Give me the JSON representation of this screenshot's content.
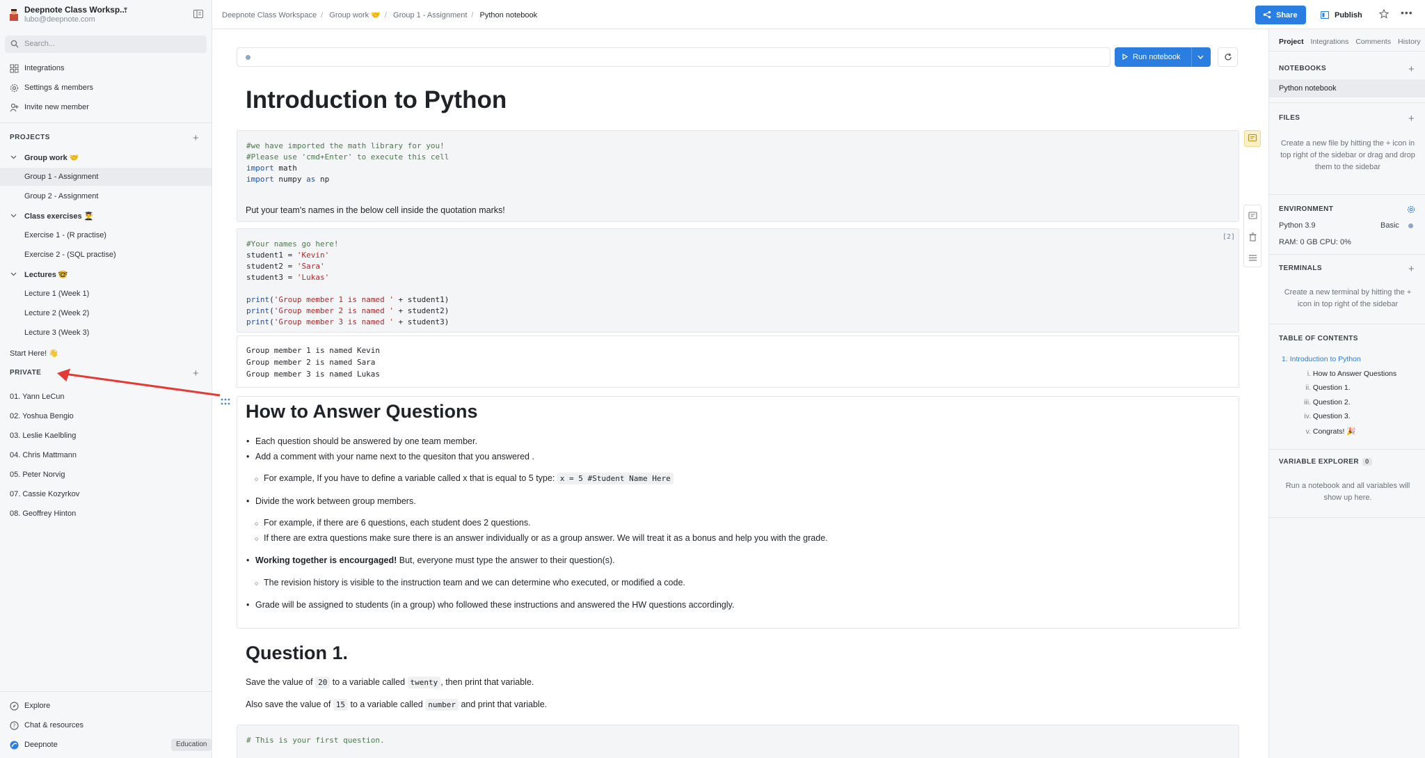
{
  "workspace": {
    "name": "Deepnote Class Worksp...",
    "email": "lubo@deepnote.com"
  },
  "search": {
    "placeholder": "Search..."
  },
  "nav": [
    {
      "label": "Integrations",
      "icon": "grid-icon"
    },
    {
      "label": "Settings & members",
      "icon": "gear-icon"
    },
    {
      "label": "Invite new member",
      "icon": "add-user-icon"
    }
  ],
  "projects": {
    "title": "PROJECTS",
    "items": [
      {
        "label": "Group work 🤝"
      },
      {
        "label": "Group 1 - Assignment"
      },
      {
        "label": "Group 2 - Assignment"
      },
      {
        "label": "Class exercises 👨‍🎓"
      },
      {
        "label": "Exercise 1 - (R practise)"
      },
      {
        "label": "Exercise 2 - (SQL practise)"
      },
      {
        "label": "Lectures 🤓"
      },
      {
        "label": "Lecture 1 (Week 1)"
      },
      {
        "label": "Lecture 2 (Week 2)"
      },
      {
        "label": "Lecture 3 (Week 3)"
      },
      {
        "label": "Start Here! 👋"
      }
    ]
  },
  "private": {
    "title": "PRIVATE",
    "items": [
      "01. Yann LeCun",
      "02. Yoshua Bengio",
      "03. Leslie Kaelbling",
      "04. Chris Mattmann",
      "05. Peter Norvig",
      "07. Cassie Kozyrkov",
      "08. Geoffrey Hinton"
    ]
  },
  "footer": {
    "explore": "Explore",
    "chat": "Chat & resources",
    "deepnote": "Deepnote",
    "badge": "Education"
  },
  "breadcrumb": [
    "Deepnote Class Workspace",
    "Group work 🤝",
    "Group 1 - Assignment",
    "Python notebook"
  ],
  "topbar": {
    "share": "Share",
    "publish": "Publish"
  },
  "toolbar": {
    "run": "Run notebook"
  },
  "notebook": {
    "title": "Introduction to Python",
    "cell1": {
      "line1": "#we have imported the math library for you!",
      "line2": "#Please use 'cmd+Enter' to execute this cell",
      "line3_kw": "import",
      "line3_rest": " math",
      "line4_kw": "import",
      "line4_mid": " numpy ",
      "line4_as": "as",
      "line4_end": " np"
    },
    "para1": "Put your team's names in the below cell inside the quotation marks!",
    "cell2": {
      "index": "[2]",
      "comment": "#Your names go here!",
      "s1_var": "student1 = ",
      "s1_val": "'Kevin'",
      "s2_var": "student2 = ",
      "s2_val": "'Sara'",
      "s3_var": "student3 = ",
      "s3_val": "'Lukas'",
      "print": "print",
      "p1_str": "'Group member 1 is named '",
      "p1_end": " + student1)",
      "p2_str": "'Group member 2 is named '",
      "p2_end": " + student2)",
      "p3_str": "'Group member 3 is named '",
      "p3_end": " + student3)"
    },
    "output": [
      "Group member 1 is named Kevin",
      "Group member 2 is named Sara",
      "Group member 3 is named Lukas"
    ],
    "howto": {
      "title": "How to Answer Questions",
      "b1": "Each question should be answered by one team member.",
      "b2": "Add a comment with your name next to the quesiton that you answered .",
      "b2a": "For example, If you have to define a variable called x that is equal to 5 type: ",
      "b2a_code": "x = 5 #Student Name Here",
      "b3": "Divide the work between group members.",
      "b3a": "For example, if there are 6 questions, each student does 2 questions.",
      "b3b": "If there are extra questions make sure there is an answer individually or as a group answer. We will treat it as a bonus and help you with the grade.",
      "b4_bold": "Working together is encourgaged!",
      "b4_rest": " But, everyone must type the answer to their question(s).",
      "b4a": "The revision history is visible to the instruction team and we can determine who executed, or modified a code.",
      "b5": "Grade will be assigned to students (in a group) who followed these instructions and answered the HW questions accordingly."
    },
    "q1": {
      "title": "Question 1.",
      "p1_a": "Save the value of ",
      "p1_code1": "20",
      "p1_b": " to a variable called ",
      "p1_code2": "twenty",
      "p1_c": ", then print that variable.",
      "p2_a": "Also save the value of ",
      "p2_code1": "15",
      "p2_b": " to a variable called ",
      "p2_code2": "number",
      "p2_c": " and print that variable.",
      "code": "# This is your first question."
    }
  },
  "right": {
    "tabs": [
      "Project",
      "Integrations",
      "Comments",
      "History"
    ],
    "notebooks_title": "NOTEBOOKS",
    "notebook": "Python notebook",
    "files_title": "FILES",
    "files_help": "Create a new file by hitting the + icon in top right of the sidebar or drag and drop them to the sidebar",
    "env_title": "ENVIRONMENT",
    "env_python": "Python 3.9",
    "env_tier": "Basic",
    "env_res": "RAM: 0 GB   CPU: 0%",
    "terminals_title": "TERMINALS",
    "terminals_help": "Create a new terminal by hitting the + icon in top right of the sidebar",
    "toc_title": "TABLE OF CONTENTS",
    "toc": [
      {
        "n": "1.",
        "label": "Introduction to Python"
      },
      {
        "n": "i.",
        "label": "How to Answer Questions"
      },
      {
        "n": "ii.",
        "label": "Question 1."
      },
      {
        "n": "iii.",
        "label": "Question 2."
      },
      {
        "n": "iv.",
        "label": "Question 3."
      },
      {
        "n": "v.",
        "label": "Congrats! 🎉"
      }
    ],
    "var_title": "VARIABLE EXPLORER",
    "var_count": "0",
    "var_help": "Run a notebook and all variables will show up here."
  },
  "colors": {
    "accent": "#2a7de1",
    "arrow": "#e53935",
    "success": "#1fa750"
  }
}
